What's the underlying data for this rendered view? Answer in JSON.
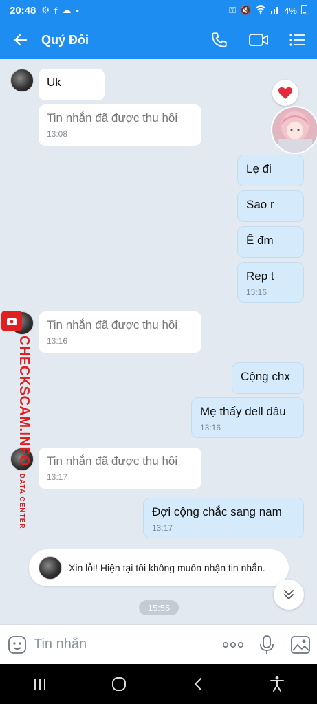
{
  "status_bar": {
    "time": "20:48",
    "battery": "4%"
  },
  "header": {
    "title": "Quý Đôi"
  },
  "messages": [
    {
      "text": "Uk"
    },
    {
      "text": "Tin nhắn đã được thu hồi",
      "time": "13:08"
    },
    {
      "text": "Lẹ đi"
    },
    {
      "text": "Sao r"
    },
    {
      "text": "Ê đm"
    },
    {
      "text": "Rep t",
      "time": "13:16"
    },
    {
      "text": "Tin nhắn đã được thu hồi",
      "time": "13:16"
    },
    {
      "text": "Cộng chx"
    },
    {
      "text": "Mẹ thấy dell đâu",
      "time": "13:16"
    },
    {
      "text": "Tin nhắn đã được thu hồi",
      "time": "13:17"
    },
    {
      "text": "Đợi cộng chắc sang nam",
      "time": "13:17"
    }
  ],
  "watermark": {
    "main": "CHECKSCAM.INFO",
    "sub": "DATA CENTER"
  },
  "auto_reply": "Xin lỗi! Hiện tại tôi không muốn nhận tin nhắn.",
  "time_divider": "15:55",
  "input": {
    "placeholder": "Tin nhắn"
  },
  "colors": {
    "accent": "#1e8df2",
    "outgoing_bubble": "#d5ebfb",
    "incoming_bubble": "#ffffff",
    "chat_background": "#e2e9f1",
    "watermark": "#e02020"
  }
}
